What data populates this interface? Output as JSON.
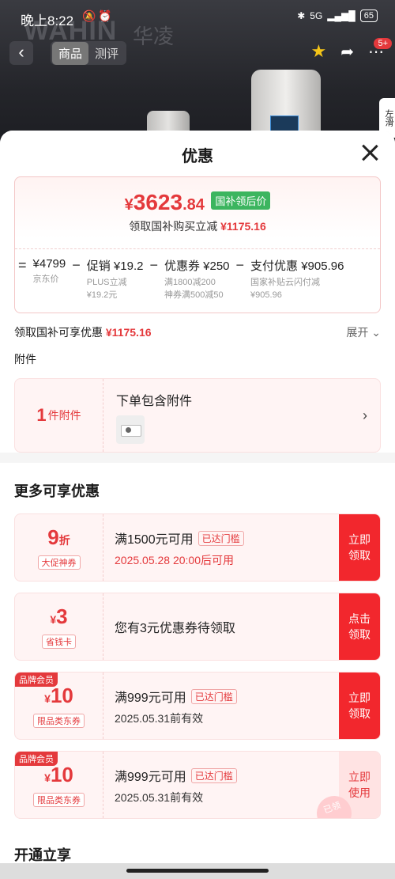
{
  "status_bar": {
    "time": "晚上8:22",
    "network": "5G",
    "battery": "65"
  },
  "background": {
    "brand_latin": "WAHIN",
    "brand_cn": "华凌",
    "tabs": [
      "商品",
      "测评"
    ],
    "notification_count": "5+",
    "side_tab": "左滑"
  },
  "sheet": {
    "title": "优惠",
    "price": {
      "yen": "¥",
      "integer": "3623",
      "decimal": ".84",
      "tag": "国补领后价",
      "sub_text": "领取国补购买立减",
      "sub_amount": "¥1175.16"
    },
    "formula": [
      {
        "op": "=",
        "main": "¥4799",
        "sub": [
          "京东价"
        ]
      },
      {
        "op": "−",
        "main": "促销 ¥19.2",
        "sub": [
          "PLUS立减",
          "¥19.2元"
        ]
      },
      {
        "op": "−",
        "main": "优惠券 ¥250",
        "sub": [
          "满1800减200",
          "神券满500减50"
        ]
      },
      {
        "op": "−",
        "main": "支付优惠 ¥905.96",
        "sub": [
          "国家补贴云闪付减",
          "¥905.96"
        ]
      }
    ],
    "subsidy_row": {
      "text": "领取国补可享优惠",
      "amount": "¥1175.16",
      "expand": "展开"
    },
    "attachment": {
      "section_label": "附件",
      "count": "1",
      "count_label": "件附件",
      "title": "下单包含附件"
    },
    "more": {
      "title": "更多可享优惠",
      "coupons": [
        {
          "flag": "",
          "value": "9",
          "unit_after": "折",
          "unit_before": "",
          "tag": "大促神券",
          "line1": "满1500元可用",
          "reached": "已达门槛",
          "line2": "2025.05.28 20:00后可用",
          "line2_red": true,
          "single": "",
          "button": "立即领取",
          "button_light": false
        },
        {
          "flag": "",
          "value": "3",
          "unit_after": "",
          "unit_before": "¥",
          "tag": "省钱卡",
          "line1": "",
          "reached": "",
          "line2": "",
          "line2_red": false,
          "single": "您有3元优惠券待领取",
          "button": "点击领取",
          "button_light": false
        },
        {
          "flag": "品牌会员",
          "value": "10",
          "unit_after": "",
          "unit_before": "¥",
          "tag": "限品类东券",
          "line1": "满999元可用",
          "reached": "已达门槛",
          "line2": "2025.05.31前有效",
          "line2_red": false,
          "single": "",
          "button": "立即领取",
          "button_light": false
        },
        {
          "flag": "品牌会员",
          "value": "10",
          "unit_after": "",
          "unit_before": "¥",
          "tag": "限品类东券",
          "line1": "满999元可用",
          "reached": "已达门槛",
          "line2": "2025.05.31前有效",
          "line2_red": false,
          "single": "",
          "button": "立即使用",
          "button_light": true
        }
      ],
      "stamp": "已领"
    },
    "open_title": "开通立享"
  },
  "colors": {
    "accent_red": "#e4393c",
    "green_tag": "#3cb55f"
  }
}
